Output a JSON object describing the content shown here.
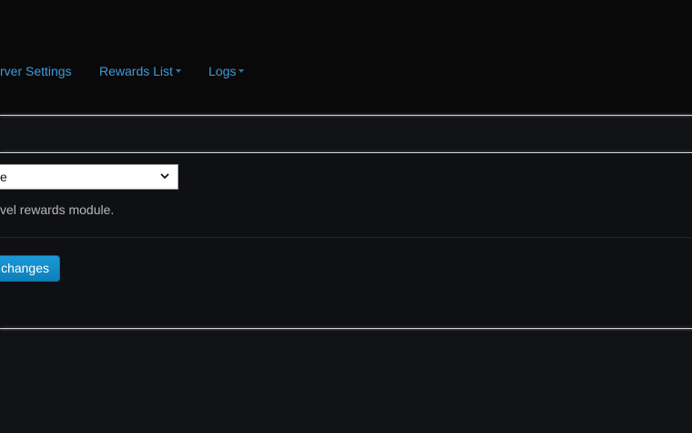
{
  "nav": {
    "items": [
      {
        "label": "rver Settings",
        "has_caret": false
      },
      {
        "label": "Rewards List",
        "has_caret": true
      },
      {
        "label": "Logs",
        "has_caret": true
      }
    ]
  },
  "form": {
    "select_value": "e",
    "help_text": "vel rewards module.",
    "save_label": "changes"
  },
  "colors": {
    "link": "#3d9bd6",
    "button": "#1a9ad6",
    "background": "#111215"
  }
}
